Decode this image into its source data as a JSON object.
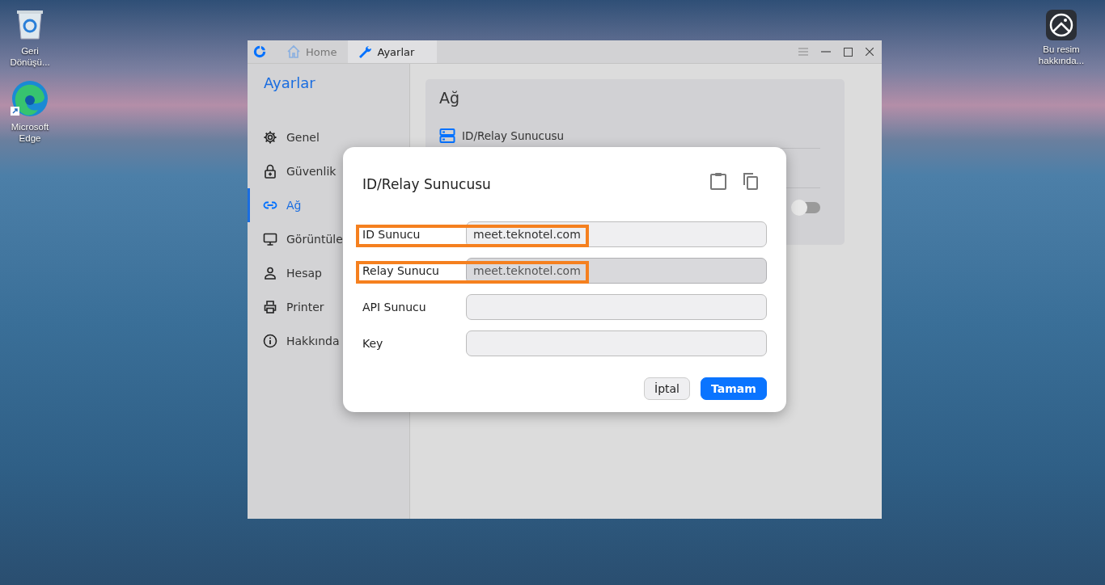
{
  "desktop": {
    "icons": [
      {
        "kind": "recycle",
        "label": "Geri Dönüşü..."
      },
      {
        "kind": "edge",
        "label": "Microsoft Edge"
      },
      {
        "kind": "about",
        "label": "Bu resim hakkında..."
      }
    ]
  },
  "window": {
    "tabs": [
      {
        "kind": "home",
        "label": "Home",
        "selected": false
      },
      {
        "kind": "wrench",
        "label": "Ayarlar",
        "selected": true
      }
    ]
  },
  "sidebar": {
    "title": "Ayarlar",
    "items": [
      {
        "kind": "gear",
        "label": "Genel",
        "selected": false
      },
      {
        "kind": "lock",
        "label": "Güvenlik",
        "selected": false
      },
      {
        "kind": "link",
        "label": "Ağ",
        "selected": true
      },
      {
        "kind": "monitor",
        "label": "Görüntüle",
        "selected": false
      },
      {
        "kind": "person",
        "label": "Hesap",
        "selected": false
      },
      {
        "kind": "printer",
        "label": "Printer",
        "selected": false
      },
      {
        "kind": "info",
        "label": "Hakkında",
        "selected": false
      }
    ]
  },
  "card": {
    "title": "Ağ",
    "item": "ID/Relay Sunucusu",
    "toggle": {
      "on": false
    }
  },
  "dialog": {
    "title": "ID/Relay Sunucusu",
    "fields": [
      {
        "label": "ID Sunucu",
        "value": "meet.teknotel.com",
        "disabled": false,
        "highlighted": true
      },
      {
        "label": "Relay Sunucu",
        "value": "meet.teknotel.com",
        "disabled": true,
        "highlighted": true
      },
      {
        "label": "API Sunucu",
        "disabled": false,
        "highlighted": false
      },
      {
        "label": "Key",
        "disabled": false,
        "highlighted": false
      }
    ],
    "buttons": [
      {
        "kind": "secondary",
        "label": "İptal"
      },
      {
        "kind": "primary",
        "label": "Tamam"
      }
    ]
  }
}
